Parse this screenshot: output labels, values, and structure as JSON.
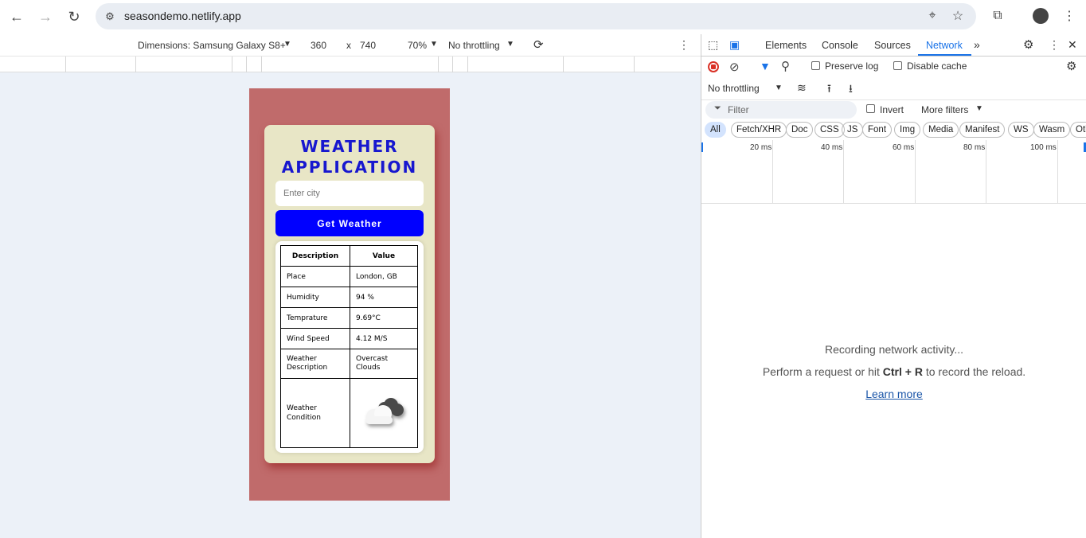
{
  "browser": {
    "url": "seasondemo.netlify.app"
  },
  "device_toolbar": {
    "dimensions_label": "Dimensions: Samsung Galaxy S8+",
    "width": "360",
    "times": "x",
    "height": "740",
    "zoom": "70%",
    "throttling": "No throttling"
  },
  "app": {
    "title_line1": "WEATHER",
    "title_line2": "APPLICATION",
    "city_placeholder": "Enter city",
    "button_label": "Get Weather",
    "table_headers": [
      "Description",
      "Value"
    ],
    "rows": [
      {
        "label": "Place",
        "value": "London, GB"
      },
      {
        "label": "Humidity",
        "value": "94 %"
      },
      {
        "label": "Temprature",
        "value": "9.69°C"
      },
      {
        "label": "Wind Speed",
        "value": "4.12 M/S"
      },
      {
        "label": "Weather Description",
        "value": "Overcast Clouds"
      },
      {
        "label": "Weather Condition",
        "value": ""
      }
    ]
  },
  "devtools": {
    "tabs": [
      "Elements",
      "Console",
      "Sources",
      "Network"
    ],
    "active_tab": "Network",
    "preserve_log": "Preserve log",
    "disable_cache": "Disable cache",
    "throttling": "No throttling",
    "filter_placeholder": "Filter",
    "invert": "Invert",
    "more_filters": "More filters",
    "chips": [
      "All",
      "Fetch/XHR",
      "Doc",
      "CSS",
      "JS",
      "Font",
      "Img",
      "Media",
      "Manifest",
      "WS",
      "Wasm",
      "Oth"
    ],
    "timeline_labels": [
      "20 ms",
      "40 ms",
      "60 ms",
      "80 ms",
      "100 ms"
    ],
    "recording": "Recording network activity...",
    "hint_pre": "Perform a request or hit ",
    "hint_key": "Ctrl + R",
    "hint_post": " to record the reload.",
    "learn_more": "Learn more"
  }
}
